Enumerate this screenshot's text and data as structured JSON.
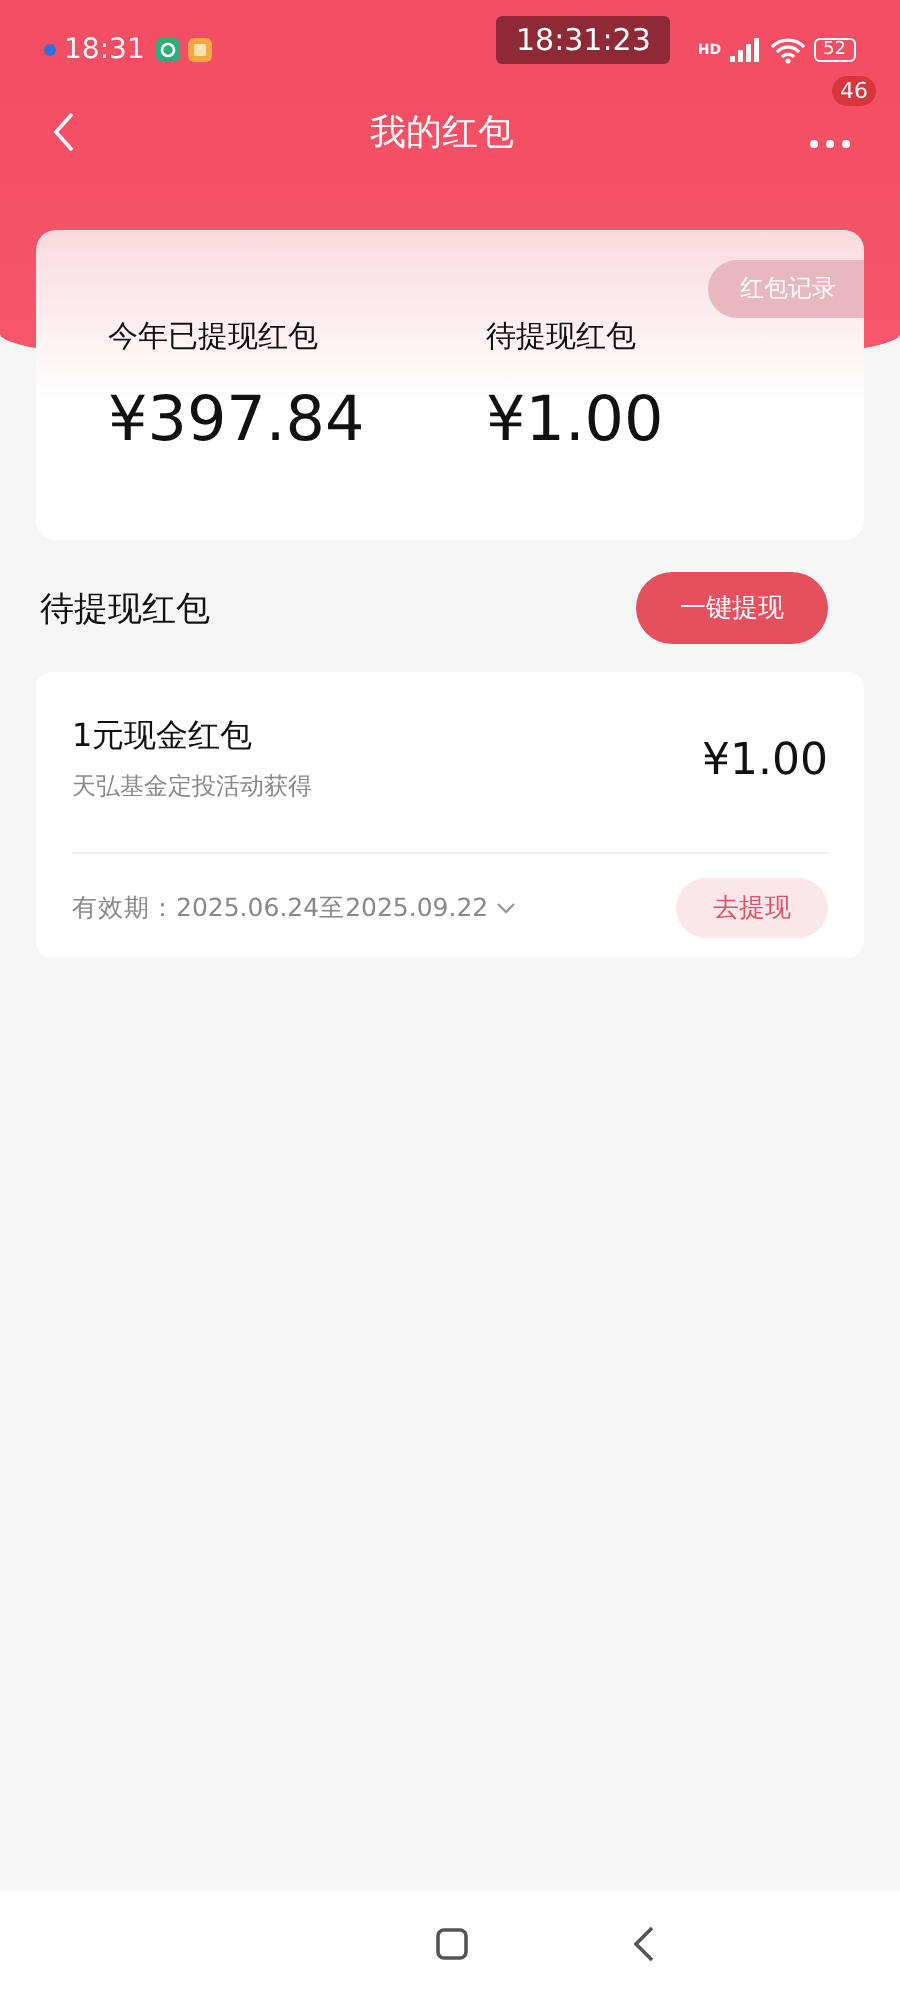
{
  "status_bar": {
    "time": "18:31",
    "clock": "18:31:23",
    "network": "HD",
    "battery": "52"
  },
  "nav": {
    "title": "我的红包",
    "badge": "46"
  },
  "summary": {
    "record_button": "红包记录",
    "stats": [
      {
        "label": "今年已提现红包",
        "amount": "¥397.84"
      },
      {
        "label": "待提现红包",
        "amount": "¥1.00"
      }
    ]
  },
  "section": {
    "title": "待提现红包",
    "action": "一键提现"
  },
  "packets": [
    {
      "name": "1元现金红包",
      "source": "天弘基金定投活动获得",
      "amount": "¥1.00",
      "validity": "有效期：2025.06.24至2025.09.22",
      "action": "去提现",
      "expanded": false
    }
  ]
}
